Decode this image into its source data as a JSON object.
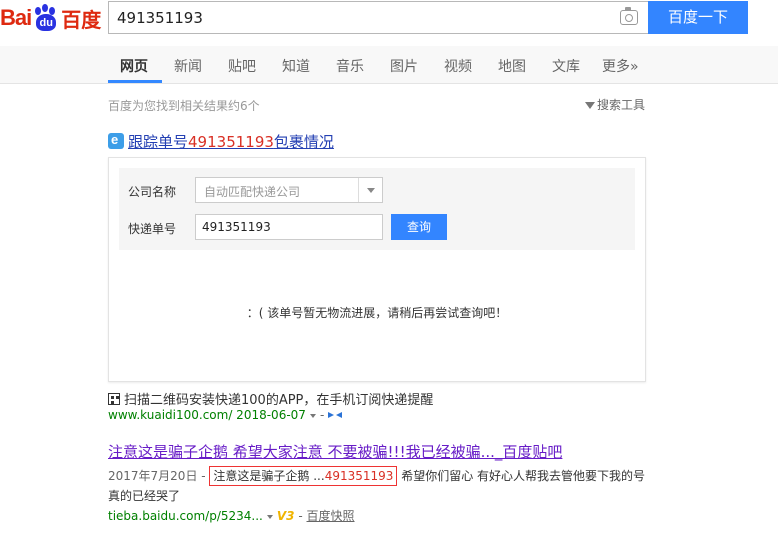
{
  "brand": {
    "latin_a": "Bai",
    "paw_text": "du",
    "cn": "百度"
  },
  "search": {
    "query": "491351193",
    "button_label": "百度一下"
  },
  "nav": {
    "items": [
      "网页",
      "新闻",
      "贴吧",
      "知道",
      "音乐",
      "图片",
      "视频",
      "地图",
      "文库",
      "更多»"
    ],
    "active_index": 0
  },
  "results_meta": {
    "count_text": "百度为您找到相关结果约6个",
    "tools_label": "搜索工具"
  },
  "result1": {
    "title_prefix": "跟踪单号",
    "title_number": "491351193",
    "title_suffix": "包裹情况",
    "company_label": "公司名称",
    "company_placeholder": "自动匹配快递公司",
    "tracking_label": "快递单号",
    "tracking_value": "491351193",
    "query_button": "查询",
    "no_info_text": "：( 该单号暂无物流进展，请稍后再尝试查询吧！",
    "qr_text": "扫描二维码安装快递100的APP，在手机订阅快递提醒",
    "url": "www.kuaidi100.com/ 2018-06-07",
    "url_sep": "-"
  },
  "result2": {
    "title": "注意这是骗子企鹅 希望大家注意 不要被骗!!!我已经被骗..._百度贴吧",
    "date": "2017年7月20日 -",
    "highlight_prefix": "注意这是骗子企鹅 ...",
    "highlight_number": "491351193",
    "snippet_rest": "希望你们留心 有好心人帮我去管他要下我的号 真的已经哭了",
    "url": "tieba.baidu.com/p/5234...",
    "v3_label": "V3",
    "sep": "-",
    "snapshot_label": "百度快照"
  },
  "colors": {
    "accent": "#3385ff",
    "link": "#2440b3",
    "visited": "#671cc7",
    "url_green": "#008000",
    "red": "#d93025"
  },
  "icons": [
    "camera-icon",
    "funnel-icon",
    "express-icon",
    "qr-icon",
    "ribbon-icon",
    "dropdown-arrow-icon"
  ]
}
